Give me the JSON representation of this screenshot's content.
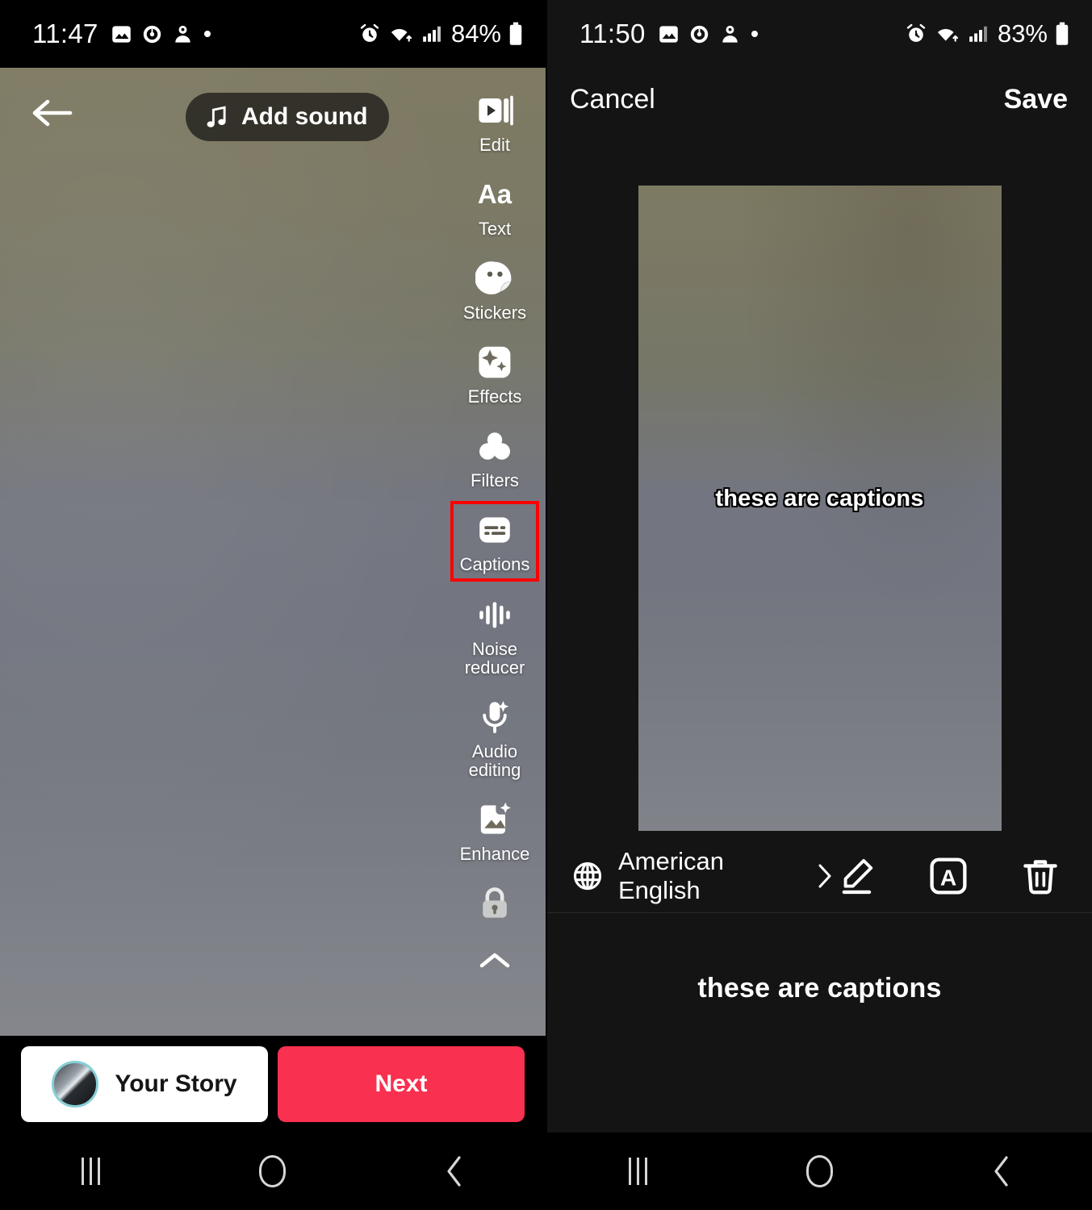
{
  "left_screen": {
    "status_bar": {
      "time": "11:47",
      "battery": "84%",
      "left_icons": [
        "image-icon",
        "alarm-clock-icon",
        "person-icon",
        "dot-icon"
      ],
      "right_icons": [
        "alarm-icon",
        "wifi-icon",
        "signal-icon",
        "battery-icon"
      ]
    },
    "back_label": "back-arrow",
    "add_sound": {
      "label": "Add sound",
      "icon": "music-note-icon"
    },
    "tools": [
      {
        "label": "Edit",
        "icon": "video-clip-icon",
        "highlighted": false
      },
      {
        "label": "Text",
        "icon": "text-aa-icon",
        "highlighted": false
      },
      {
        "label": "Stickers",
        "icon": "sticker-smiley-icon",
        "highlighted": false
      },
      {
        "label": "Effects",
        "icon": "sparkles-icon",
        "highlighted": false
      },
      {
        "label": "Filters",
        "icon": "filters-circles-icon",
        "highlighted": false
      },
      {
        "label": "Captions",
        "icon": "captions-icon",
        "highlighted": true
      },
      {
        "label": "Noise\nreducer",
        "icon": "waveform-icon",
        "highlighted": false
      },
      {
        "label": "Audio\nediting",
        "icon": "microphone-sparkle-icon",
        "highlighted": false
      },
      {
        "label": "Enhance",
        "icon": "image-sparkle-icon",
        "highlighted": false
      },
      {
        "label": "",
        "icon": "lock-icon",
        "highlighted": false
      }
    ],
    "collapse_icon": "chevron-up-icon",
    "bottom": {
      "story_label": "Your Story",
      "story_avatar": "avatar",
      "next_label": "Next",
      "next_color": "#F9304F",
      "story_bg": "#FFFFFF"
    },
    "nav_bar": [
      "recents-icon",
      "home-icon",
      "back-icon"
    ]
  },
  "right_screen": {
    "status_bar": {
      "time": "11:50",
      "battery": "83%",
      "left_icons": [
        "image-icon",
        "alarm-clock-icon",
        "person-icon",
        "dot-icon"
      ],
      "right_icons": [
        "alarm-icon",
        "wifi-icon",
        "signal-icon",
        "battery-icon"
      ]
    },
    "header": {
      "cancel_label": "Cancel",
      "save_label": "Save"
    },
    "preview": {
      "overlay_caption": "these are captions"
    },
    "toolbar": {
      "globe_icon": "globe-icon",
      "language": "American English",
      "chevron_icon": "chevron-right-icon",
      "actions": [
        "edit-pencil-icon",
        "font-style-icon",
        "delete-trash-icon"
      ]
    },
    "caption_list": [
      {
        "text": "these are captions"
      }
    ],
    "nav_bar": [
      "recents-icon",
      "home-icon",
      "back-icon"
    ]
  },
  "highlight_color": "#FF0000"
}
